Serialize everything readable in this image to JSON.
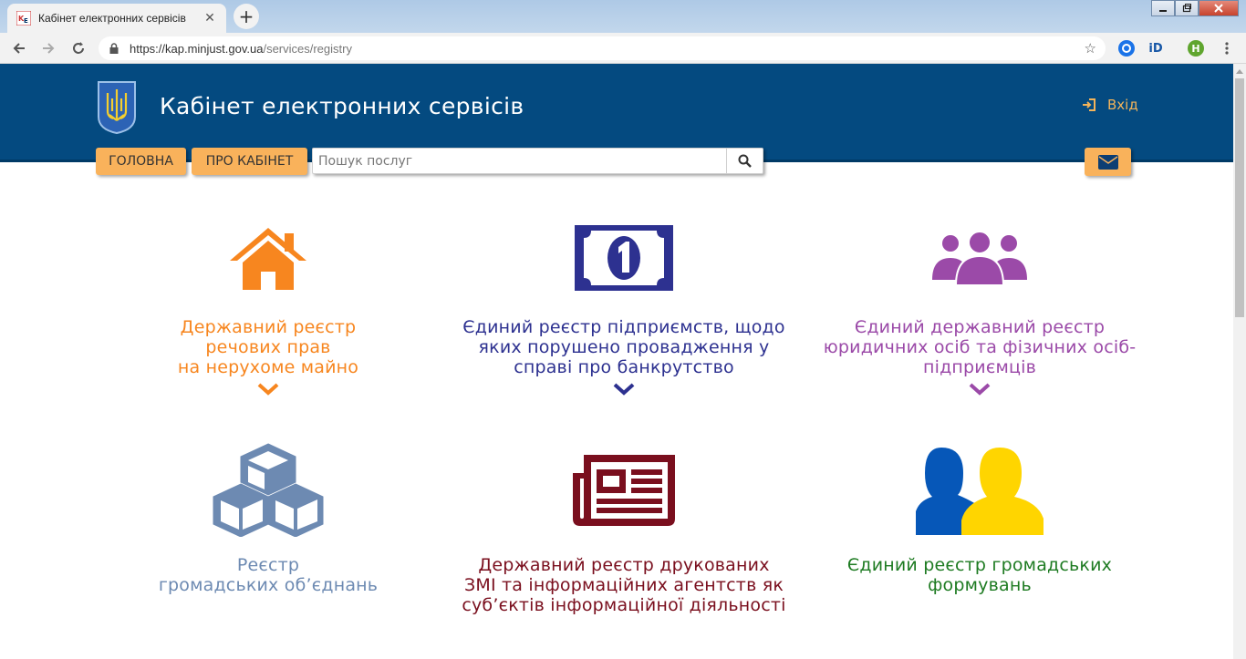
{
  "browser": {
    "tab_title": "Кабінет електронних сервісів",
    "tab_close": "✕",
    "new_tab": "+",
    "url_host": "https://kap.minjust.gov.ua",
    "url_path": "/services/registry",
    "profile_initial": "H",
    "ext_initial": "iD"
  },
  "header": {
    "title": "Кабінет електронних сервісів",
    "login_label": "Вхід",
    "nav": [
      {
        "label": "ГОЛОВНА"
      },
      {
        "label": "ПРО КАБІНЕТ"
      }
    ],
    "search_placeholder": "Пошук послуг"
  },
  "colors": {
    "header_bg": "#044a80",
    "accent": "#f9b25b",
    "orange": "#f7861f",
    "navy": "#2d3190",
    "purple": "#9b4aa8",
    "steel": "#6d8ab2",
    "maroon": "#7a0f1e",
    "green": "#1e7b22",
    "ua_blue": "#0657b8",
    "ua_yellow": "#ffd500"
  },
  "services": [
    {
      "icon": "house-icon",
      "lines": [
        "Державний реєстр",
        "речових прав",
        "на нерухоме майно"
      ],
      "color": "#f7861f",
      "expandable": true
    },
    {
      "icon": "banknote-icon",
      "lines": [
        "Єдиний реєстр підприємств, щодо",
        "яких порушено провадження у",
        "справі про банкрутство"
      ],
      "color": "#2d3190",
      "expandable": true
    },
    {
      "icon": "people-group-icon",
      "lines": [
        "Єдиний державний реєстр",
        "юридичних осіб та фізичних осіб-",
        "підприємців"
      ],
      "color": "#9b4aa8",
      "expandable": true
    },
    {
      "icon": "cubes-icon",
      "lines": [
        "Реєстр",
        "громадських об’єднань"
      ],
      "color": "#6d8ab2",
      "expandable": false
    },
    {
      "icon": "newspaper-icon",
      "lines": [
        "Державний реєстр друкованих",
        "ЗМІ та інформаційних агентств як",
        "суб’єктів інформаційної діяльності"
      ],
      "color": "#7a0f1e",
      "expandable": false
    },
    {
      "icon": "two-persons-icon",
      "lines": [
        "Єдиний реєстр громадських",
        "формувань"
      ],
      "color": "#1e7b22",
      "expandable": false
    }
  ]
}
